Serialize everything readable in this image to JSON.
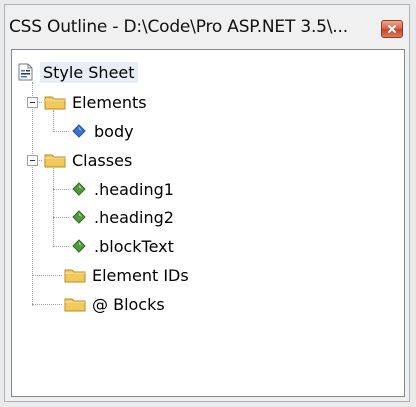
{
  "window": {
    "title": "CSS Outline - D:\\Code\\Pro ASP.NET 3.5\\..."
  },
  "tree": {
    "root": {
      "label": "Style Sheet",
      "icon": "stylesheet-icon"
    },
    "elements": {
      "label": "Elements",
      "expanded": true,
      "children": [
        {
          "label": "body",
          "icon": "element-blue-diamond-icon"
        }
      ]
    },
    "classes": {
      "label": "Classes",
      "expanded": true,
      "children": [
        {
          "label": ".heading1",
          "icon": "class-green-diamond-icon"
        },
        {
          "label": ".heading2",
          "icon": "class-green-diamond-icon"
        },
        {
          "label": ".blockText",
          "icon": "class-green-diamond-icon"
        }
      ]
    },
    "element_ids": {
      "label": "Element IDs"
    },
    "at_blocks": {
      "label": "@ Blocks"
    }
  },
  "colors": {
    "folder": "#f2c95c",
    "element_diamond": "#3b6fd1",
    "class_diamond": "#4f9a3a",
    "close_button": "#d25a3d"
  }
}
